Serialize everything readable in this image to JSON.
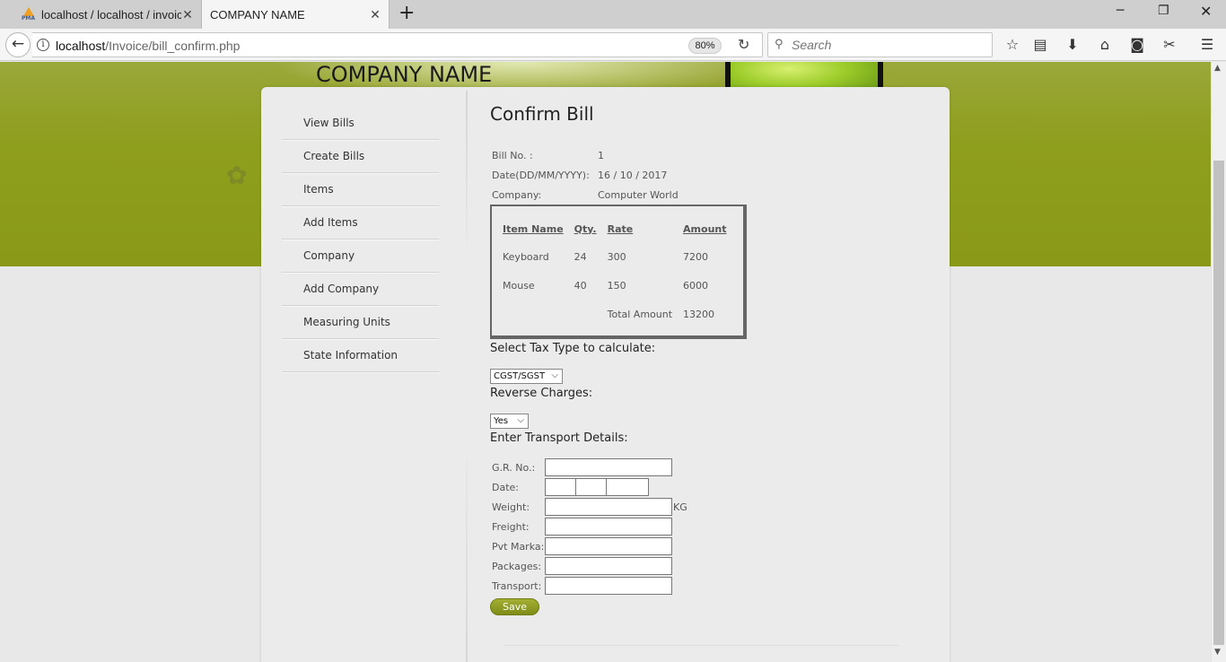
{
  "browser": {
    "tabs": [
      {
        "title": "localhost / localhost / invoice",
        "icon": "phpmyadmin-icon",
        "fav_text": "PMA",
        "active": false
      },
      {
        "title": "COMPANY NAME",
        "active": true
      }
    ],
    "url_host": "localhost",
    "url_path": "/Invoice/bill_confirm.php",
    "zoom": "80%",
    "search_placeholder": "Search"
  },
  "header": {
    "company_name": "COMPANY NAME",
    "accent_color": "#8e9e1d"
  },
  "sidebar": {
    "items": [
      {
        "label": "View Bills"
      },
      {
        "label": "Create Bills"
      },
      {
        "label": "Items"
      },
      {
        "label": "Add Items"
      },
      {
        "label": "Company"
      },
      {
        "label": "Add Company"
      },
      {
        "label": "Measuring Units"
      },
      {
        "label": "State Information"
      }
    ]
  },
  "main": {
    "title": "Confirm Bill",
    "bill_no_label": "Bill No. :",
    "bill_no": "1",
    "date_label": "Date(DD/MM/YYYY):",
    "date": "16 / 10 / 2017",
    "company_label": "Company:",
    "company": "Computer World",
    "items_table": {
      "headers": [
        "Item Name",
        "Qty.",
        "Rate",
        "Amount"
      ],
      "rows": [
        [
          "Keyboard",
          "24",
          "300",
          "7200"
        ],
        [
          "Mouse",
          "40",
          "150",
          "6000"
        ]
      ],
      "total_label": "Total Amount",
      "total": "13200"
    },
    "tax_label": "Select Tax Type to calculate:",
    "tax_selected": "CGST/SGST",
    "reverse_label": "Reverse Charges:",
    "reverse_selected": "Yes",
    "transport_label": "Enter Transport Details:",
    "transport": {
      "gr_label": "G.R. No.:",
      "date_label": "Date:",
      "weight_label": "Weight:",
      "weight_unit": "KG",
      "freight_label": "Freight:",
      "marka_label": "Pvt Marka:",
      "packages_label": "Packages:",
      "transport_label": "Transport:"
    },
    "save_label": "Save"
  }
}
